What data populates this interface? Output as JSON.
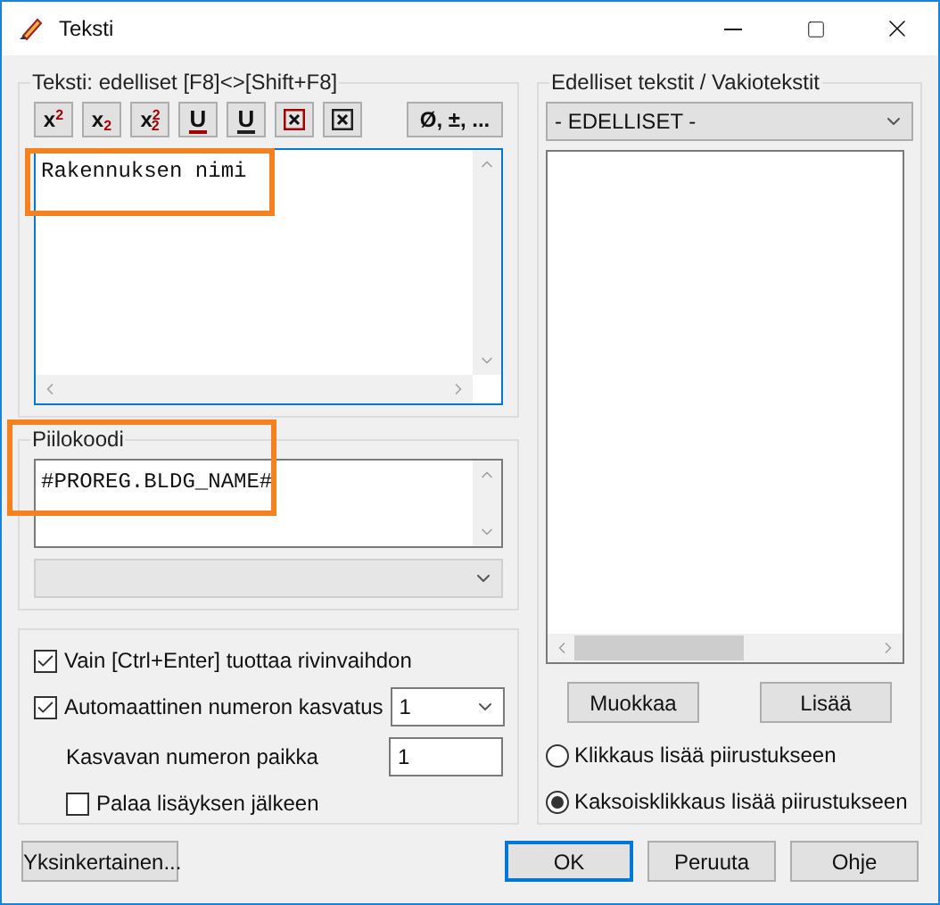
{
  "window": {
    "title": "Teksti"
  },
  "text_group": {
    "legend": "Teksti:  edelliset [F8]<>[Shift+F8]",
    "toolbar": [
      {
        "kind": "script",
        "label": "x$^{2}$"
      },
      {
        "kind": "script",
        "label": "x$_{2}$"
      },
      {
        "kind": "script",
        "label": "x$^{2}$$_{2}$"
      },
      {
        "kind": "underline",
        "label": "U",
        "color": "#a00000"
      },
      {
        "kind": "underline",
        "label": "U",
        "color": "#202020"
      },
      {
        "kind": "boxx",
        "color": "#a00000"
      },
      {
        "kind": "boxx",
        "color": "#202020"
      }
    ],
    "symbols_button": "Ø, ±, ...",
    "value": "Rakennuksen nimi",
    "highlighted": true
  },
  "code_group": {
    "legend": "Piilokoodi",
    "value": "#PROREG.BLDG_NAME#",
    "highlighted": true,
    "dropdown_disabled": true
  },
  "options": [
    {
      "kind": "checkbox",
      "label": "Vain [Ctrl+Enter] tuottaa rivinvaihdon",
      "checked": true
    },
    {
      "kind": "checkbox_combo",
      "label": "Automaattinen numeron kasvatus",
      "checked": true,
      "value": "1"
    },
    {
      "kind": "field",
      "label": "Kasvavan numeron paikka",
      "value": "1"
    },
    {
      "kind": "sub_checkbox",
      "label": "Palaa lisäyksen jälkeen",
      "checked": false
    }
  ],
  "right_group": {
    "legend": "Edelliset tekstit / Vakiotekstit",
    "dropdown": "- EDELLISET -",
    "buttons": [
      "Muokkaa",
      "Lisää"
    ],
    "radios": [
      {
        "label": "Klikkaus lisää piirustukseen",
        "selected": false
      },
      {
        "label": "Kaksoisklikkaus lisää piirustukseen",
        "selected": true
      }
    ]
  },
  "footer": {
    "left_button": "Yksinkertainen...",
    "buttons": [
      {
        "label": "OK",
        "default": true
      },
      {
        "label": "Peruuta",
        "default": false
      },
      {
        "label": "Ohje",
        "default": false
      }
    ]
  }
}
